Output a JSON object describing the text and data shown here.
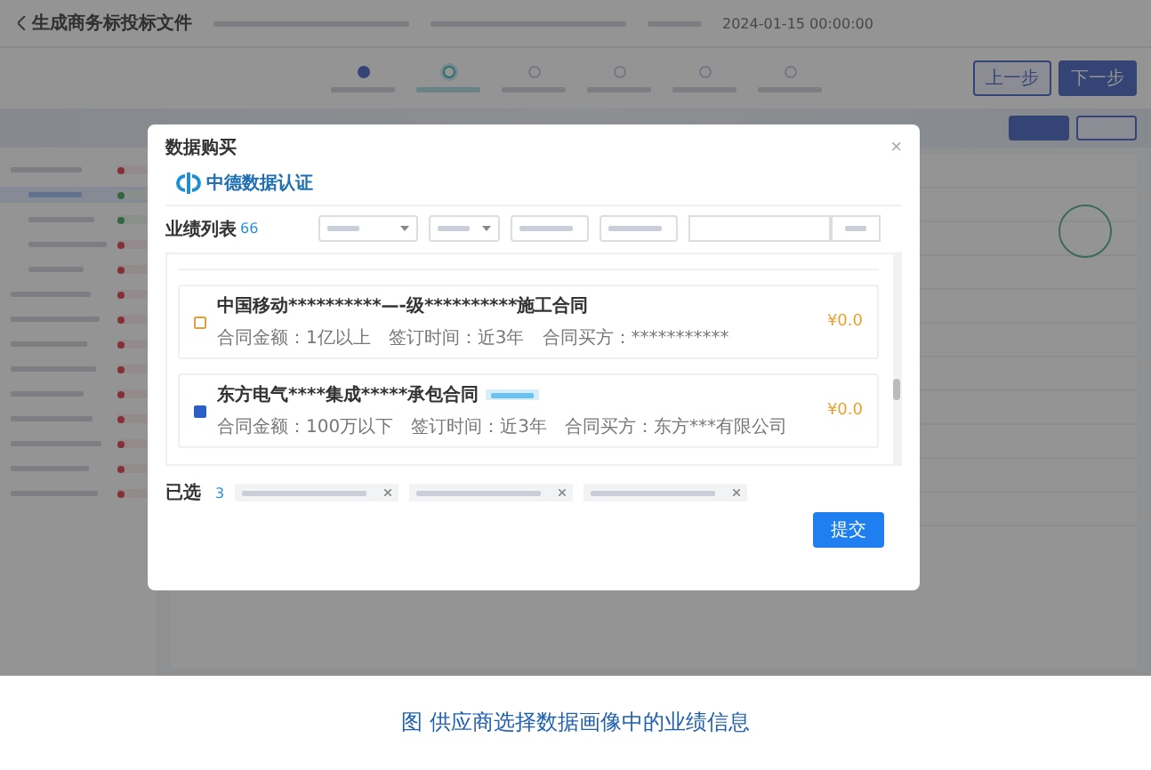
{
  "app": {
    "back_title": "生成商务标投标文件",
    "deadline": "2024-01-15 00:00:00",
    "steps": [
      {
        "completed": true,
        "selected": false
      },
      {
        "completed": false,
        "selected": true
      },
      {
        "completed": false,
        "selected": false
      },
      {
        "completed": false,
        "selected": false
      },
      {
        "completed": false,
        "selected": false
      },
      {
        "completed": false,
        "selected": false
      }
    ],
    "nav_buttons": [
      "上一步",
      "下一步"
    ],
    "tree": [
      {
        "done": false,
        "selected": false,
        "children": [
          {
            "done": true,
            "selected": true
          },
          {
            "done": true,
            "selected": false
          },
          {
            "done": false,
            "selected": false
          },
          {
            "done": false,
            "selected": false
          }
        ]
      },
      {
        "done": false,
        "selected": false
      },
      {
        "done": false,
        "selected": false
      },
      {
        "done": false,
        "selected": false
      },
      {
        "done": false,
        "selected": false
      },
      {
        "done": false,
        "selected": false
      },
      {
        "done": false,
        "selected": false
      },
      {
        "done": false,
        "selected": false
      },
      {
        "done": false,
        "selected": false
      },
      {
        "done": false,
        "selected": false
      }
    ]
  },
  "dialog": {
    "title": "数据购买",
    "close": "×",
    "logo": "中德数据认证",
    "list_title": "业绩列表",
    "count": "66",
    "records": [
      {
        "title": "中国移动**********—-级**********施工合同",
        "tagged": false,
        "checked": false,
        "meta": [
          "合同金额：1亿以上",
          "签订时间：近3年",
          "合同买方：***********"
        ],
        "price": "¥0.0"
      },
      {
        "title": "东方电气****集成*****承包合同",
        "tagged": true,
        "checked": true,
        "meta": [
          "合同金额：100万以下",
          "签订时间：近3年",
          "合同买方：东方***有限公司"
        ],
        "price": "¥0.0"
      }
    ],
    "selected_label": "已选",
    "selected_count": "3",
    "chips": [
      {
        "removable": true
      },
      {
        "removable": true
      },
      {
        "removable": true
      }
    ],
    "submit": "提交"
  },
  "caption": "图 供应商选择数据画像中的业绩信息"
}
